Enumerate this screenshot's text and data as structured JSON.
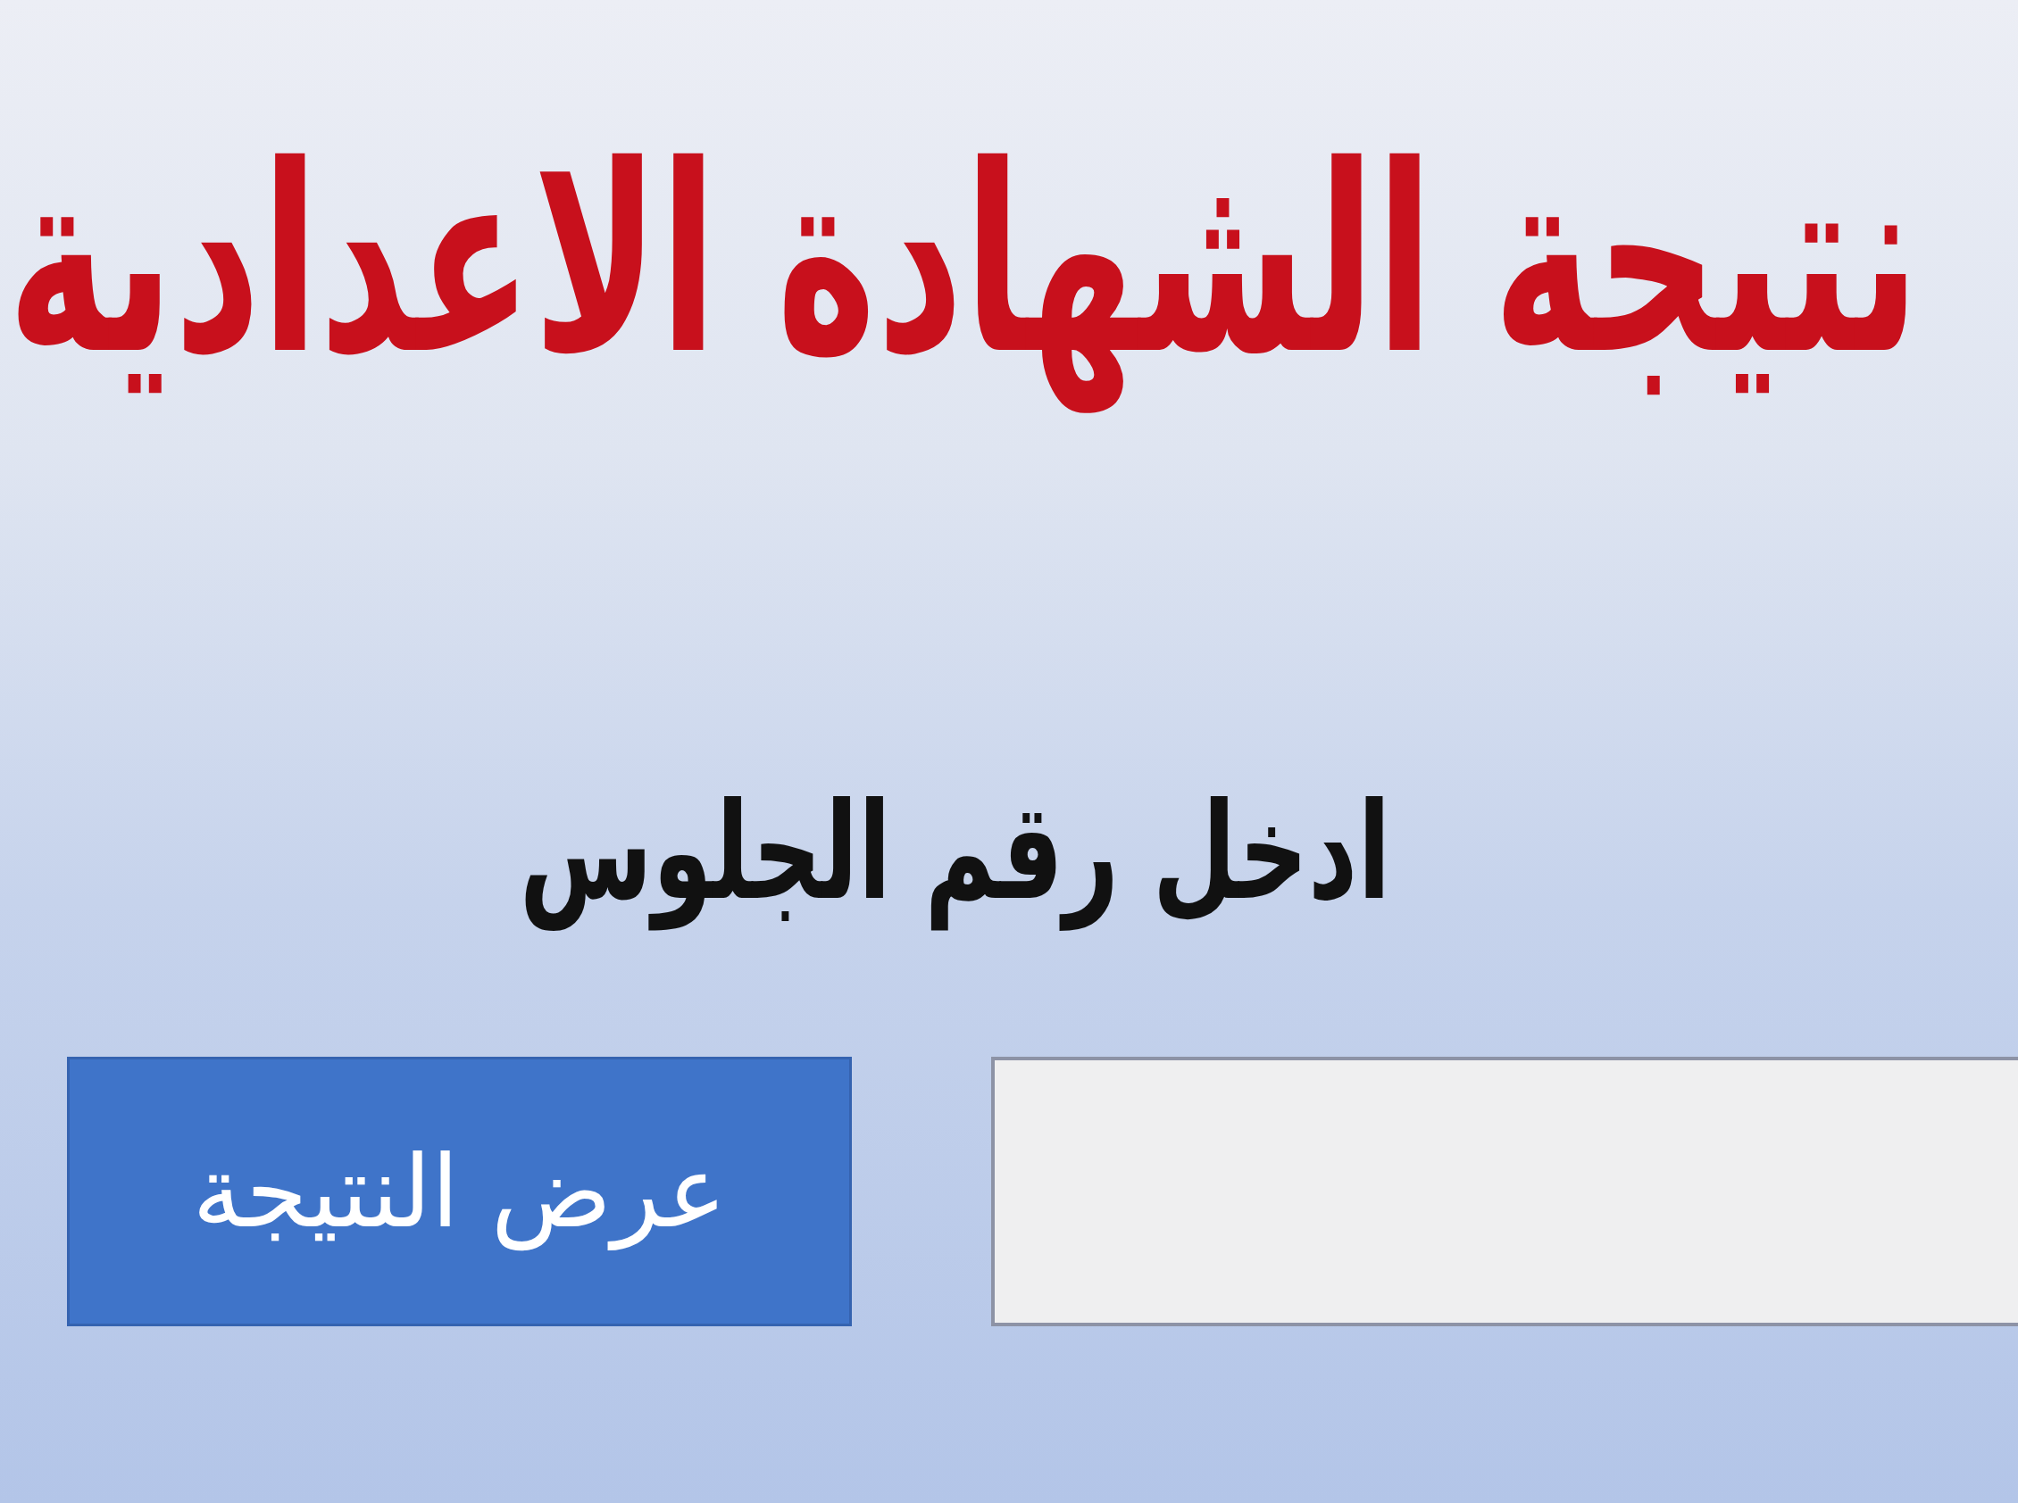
{
  "title": "نتيجة الشهادة الاعدادية",
  "seat_number": {
    "label": "ادخل رقم الجلوس"
  },
  "submit_button": {
    "label": "عرض النتيجة"
  }
}
